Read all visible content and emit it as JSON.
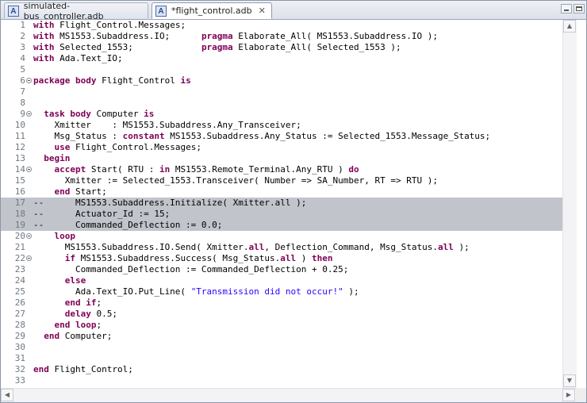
{
  "tabs": [
    {
      "label": "simulated-bus_controller.adb",
      "icon": "ada-file-icon",
      "active": false
    },
    {
      "label": "*flight_control.adb",
      "icon": "ada-file-icon",
      "active": true,
      "close": "✕"
    }
  ],
  "editor": {
    "highlighted_lines": [
      17,
      18,
      19
    ],
    "lines": [
      {
        "n": "1",
        "fold": false,
        "tokens": [
          [
            "kw",
            "with"
          ],
          [
            "t",
            " Flight_Control.Messages;"
          ]
        ]
      },
      {
        "n": "2",
        "fold": false,
        "tokens": [
          [
            "kw",
            "with"
          ],
          [
            "t",
            " MS1553.Subaddress.IO;      "
          ],
          [
            "kw",
            "pragma"
          ],
          [
            "t",
            " Elaborate_All( MS1553.Subaddress.IO );"
          ]
        ]
      },
      {
        "n": "3",
        "fold": false,
        "tokens": [
          [
            "kw",
            "with"
          ],
          [
            "t",
            " Selected_1553;             "
          ],
          [
            "kw",
            "pragma"
          ],
          [
            "t",
            " Elaborate_All( Selected_1553 );"
          ]
        ]
      },
      {
        "n": "4",
        "fold": false,
        "tokens": [
          [
            "kw",
            "with"
          ],
          [
            "t",
            " Ada.Text_IO;"
          ]
        ]
      },
      {
        "n": "5",
        "fold": false,
        "tokens": []
      },
      {
        "n": "6",
        "fold": true,
        "tokens": [
          [
            "kw",
            "package body"
          ],
          [
            "t",
            " Flight_Control "
          ],
          [
            "kw",
            "is"
          ]
        ]
      },
      {
        "n": "7",
        "fold": false,
        "tokens": []
      },
      {
        "n": "8",
        "fold": false,
        "tokens": []
      },
      {
        "n": "9",
        "fold": true,
        "tokens": [
          [
            "t",
            "  "
          ],
          [
            "kw",
            "task body"
          ],
          [
            "t",
            " Computer "
          ],
          [
            "kw",
            "is"
          ]
        ]
      },
      {
        "n": "10",
        "fold": false,
        "tokens": [
          [
            "t",
            "    Xmitter    : MS1553.Subaddress.Any_Transceiver;"
          ]
        ]
      },
      {
        "n": "11",
        "fold": false,
        "tokens": [
          [
            "t",
            "    Msg_Status : "
          ],
          [
            "kw",
            "constant"
          ],
          [
            "t",
            " MS1553.Subaddress.Any_Status := Selected_1553.Message_Status;"
          ]
        ]
      },
      {
        "n": "12",
        "fold": false,
        "tokens": [
          [
            "t",
            "    "
          ],
          [
            "kw",
            "use"
          ],
          [
            "t",
            " Flight_Control.Messages;"
          ]
        ]
      },
      {
        "n": "13",
        "fold": false,
        "tokens": [
          [
            "t",
            "  "
          ],
          [
            "kw",
            "begin"
          ]
        ]
      },
      {
        "n": "14",
        "fold": true,
        "tokens": [
          [
            "t",
            "    "
          ],
          [
            "kw",
            "accept"
          ],
          [
            "t",
            " Start( RTU : "
          ],
          [
            "kw",
            "in"
          ],
          [
            "t",
            " MS1553.Remote_Terminal.Any_RTU ) "
          ],
          [
            "kw",
            "do"
          ]
        ]
      },
      {
        "n": "15",
        "fold": false,
        "tokens": [
          [
            "t",
            "      Xmitter := Selected_1553.Transceiver( Number => SA_Number, RT => RTU );"
          ]
        ]
      },
      {
        "n": "16",
        "fold": false,
        "tokens": [
          [
            "t",
            "    "
          ],
          [
            "kw",
            "end"
          ],
          [
            "t",
            " Start;"
          ]
        ]
      },
      {
        "n": "17",
        "fold": false,
        "tokens": [
          [
            "t",
            "--      MS1553.Subaddress.Initialize( Xmitter.all );"
          ]
        ]
      },
      {
        "n": "18",
        "fold": false,
        "tokens": [
          [
            "t",
            "--      Actuator_Id := 15;"
          ]
        ]
      },
      {
        "n": "19",
        "fold": false,
        "tokens": [
          [
            "t",
            "--      Commanded_Deflection := 0.0;"
          ]
        ]
      },
      {
        "n": "20",
        "fold": true,
        "tokens": [
          [
            "t",
            "    "
          ],
          [
            "kw",
            "loop"
          ]
        ]
      },
      {
        "n": "21",
        "fold": false,
        "tokens": [
          [
            "t",
            "      MS1553.Subaddress.IO.Send( Xmitter."
          ],
          [
            "kw",
            "all"
          ],
          [
            "t",
            ", Deflection_Command, Msg_Status."
          ],
          [
            "kw",
            "all"
          ],
          [
            "t",
            " );"
          ]
        ]
      },
      {
        "n": "22",
        "fold": true,
        "tokens": [
          [
            "t",
            "      "
          ],
          [
            "kw",
            "if"
          ],
          [
            "t",
            " MS1553.Subaddress.Success( Msg_Status."
          ],
          [
            "kw",
            "all"
          ],
          [
            "t",
            " ) "
          ],
          [
            "kw",
            "then"
          ]
        ]
      },
      {
        "n": "23",
        "fold": false,
        "tokens": [
          [
            "t",
            "        Commanded_Deflection := Commanded_Deflection + 0.25;"
          ]
        ]
      },
      {
        "n": "24",
        "fold": false,
        "tokens": [
          [
            "t",
            "      "
          ],
          [
            "kw",
            "else"
          ]
        ]
      },
      {
        "n": "25",
        "fold": false,
        "tokens": [
          [
            "t",
            "        Ada.Text_IO.Put_Line( "
          ],
          [
            "str",
            "\"Transmission did not occur!\""
          ],
          [
            "t",
            " );"
          ]
        ]
      },
      {
        "n": "26",
        "fold": false,
        "tokens": [
          [
            "t",
            "      "
          ],
          [
            "kw",
            "end if"
          ],
          [
            "t",
            ";"
          ]
        ]
      },
      {
        "n": "27",
        "fold": false,
        "tokens": [
          [
            "t",
            "      "
          ],
          [
            "kw",
            "delay"
          ],
          [
            "t",
            " 0.5;"
          ]
        ]
      },
      {
        "n": "28",
        "fold": false,
        "tokens": [
          [
            "t",
            "    "
          ],
          [
            "kw",
            "end loop"
          ],
          [
            "t",
            ";"
          ]
        ]
      },
      {
        "n": "29",
        "fold": false,
        "tokens": [
          [
            "t",
            "  "
          ],
          [
            "kw",
            "end"
          ],
          [
            "t",
            " Computer;"
          ]
        ]
      },
      {
        "n": "30",
        "fold": false,
        "tokens": []
      },
      {
        "n": "31",
        "fold": false,
        "tokens": []
      },
      {
        "n": "32",
        "fold": false,
        "tokens": [
          [
            "kw",
            "end"
          ],
          [
            "t",
            " Flight_Control;"
          ]
        ]
      },
      {
        "n": "33",
        "fold": false,
        "tokens": []
      }
    ]
  },
  "colors": {
    "keyword": "#7f0055",
    "string": "#2a00ff",
    "selection": "#c2c4cc"
  }
}
